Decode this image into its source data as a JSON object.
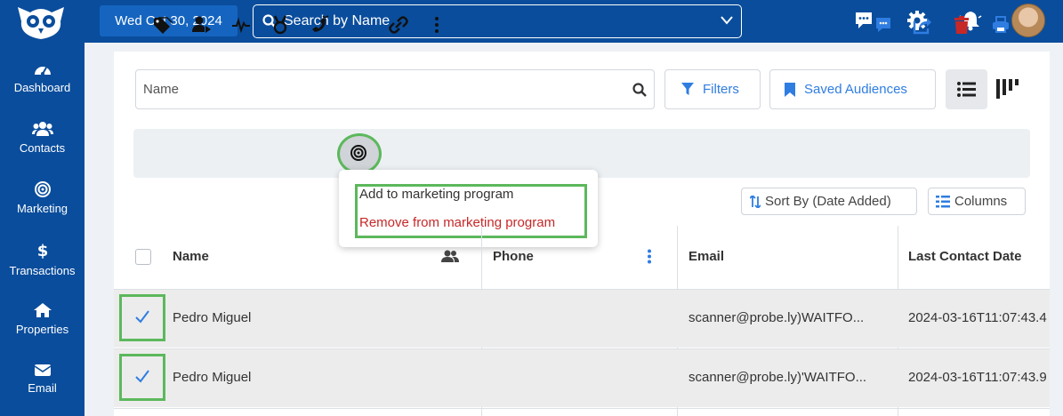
{
  "topbar": {
    "date": "Wed Oct 30, 2024",
    "search_placeholder": "Search by Name",
    "icons": [
      "chat-icon",
      "gear-icon",
      "bell-icon"
    ]
  },
  "sidebar": {
    "items": [
      {
        "label": "Dashboard",
        "icon": "gauge-icon"
      },
      {
        "label": "Contacts",
        "icon": "users-icon"
      },
      {
        "label": "Marketing",
        "icon": "target-icon"
      },
      {
        "label": "Transactions",
        "icon": "dollar-icon"
      },
      {
        "label": "Properties",
        "icon": "home-icon"
      },
      {
        "label": "Email",
        "icon": "envelope-icon"
      }
    ]
  },
  "filters": {
    "name_placeholder": "Name",
    "filters_label": "Filters",
    "saved_audiences_label": "Saved Audiences"
  },
  "toolbar": {
    "tools": [
      "tag-icon",
      "assign-user-icon",
      "activity-icon",
      "medal-icon",
      "phone-icon",
      "target-icon",
      "link-icon",
      "more-vertical-icon"
    ],
    "right_tools": [
      "message-icon",
      "share-icon",
      "trash-icon",
      "print-icon"
    ]
  },
  "dropdown": {
    "add_label": "Add to marketing program",
    "remove_label": "Remove from marketing program"
  },
  "list_controls": {
    "sort_label": "Sort By (Date Added)",
    "columns_label": "Columns"
  },
  "table": {
    "headers": [
      "Name",
      "Phone",
      "Email",
      "Last Contact Date"
    ],
    "rows": [
      {
        "name": "Pedro Miguel",
        "phone": "",
        "email": "scanner@probe.ly)WAITFO...",
        "last_contact": "2024-03-16T11:07:43.4",
        "checked": true
      },
      {
        "name": "Pedro Miguel",
        "phone": "",
        "email": "scanner@probe.ly)'WAITFO...",
        "last_contact": "2024-03-16T11:07:43.9",
        "checked": true
      }
    ]
  },
  "colors": {
    "brand": "#0a4d9c",
    "accent": "#2f7de1",
    "danger": "#c62828",
    "highlight": "#5cb85c"
  }
}
